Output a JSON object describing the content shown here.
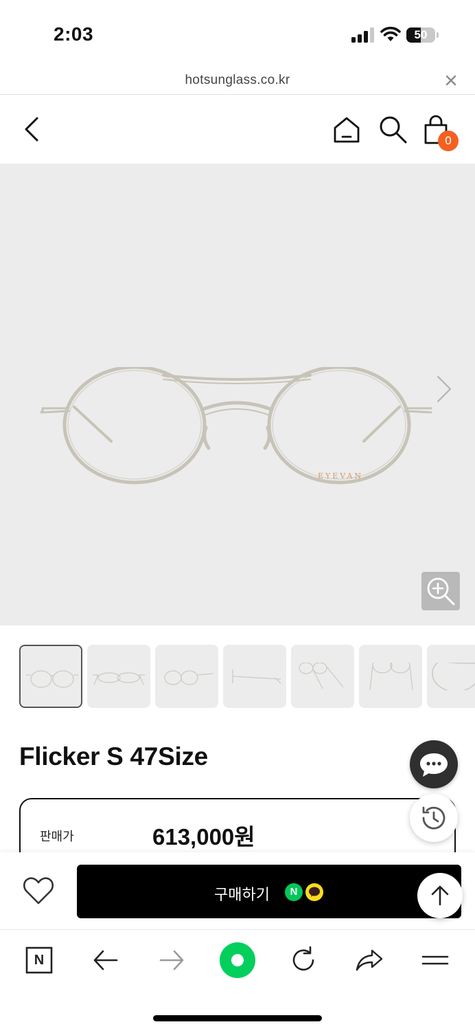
{
  "status_bar": {
    "time": "2:03",
    "battery_level": "50",
    "battery_fraction": 0.5,
    "icons": [
      "signal-icon",
      "wifi-icon",
      "battery-icon"
    ]
  },
  "browser": {
    "url": "hotsunglass.co.kr",
    "close_icon": "close-icon"
  },
  "header": {
    "icons": [
      "back-icon",
      "home-icon",
      "search-icon",
      "cart-icon"
    ],
    "cart_count": "0",
    "accent_color": "#f26122"
  },
  "product": {
    "image_brand_mark": "EYEVAN",
    "title": "Flicker S 47Size",
    "price_label": "판매가",
    "price": "613,000원",
    "thumbnail_count": 7,
    "active_thumbnail": 1
  },
  "buy_bar": {
    "buy_label": "구매하기",
    "naver_badge": "N",
    "naver_color": "#03c75a",
    "kakao_color": "#f8dc1c",
    "icons": [
      "heart-icon",
      "arrow-up-icon"
    ]
  },
  "floating": {
    "icons": [
      "chat-icon",
      "history-icon"
    ]
  },
  "toolbar": {
    "icons": [
      "naver-n-icon",
      "back-arrow-icon",
      "forward-arrow-icon",
      "green-dot-icon",
      "reload-icon",
      "share-icon",
      "menu-icon"
    ],
    "naver_n": "N"
  }
}
